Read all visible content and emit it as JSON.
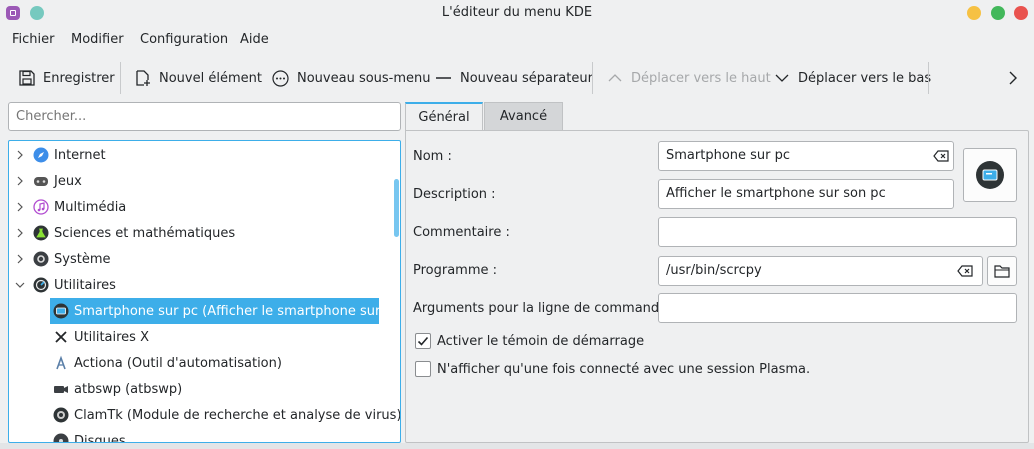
{
  "window": {
    "title": "L'éditeur du menu KDE"
  },
  "menubar": {
    "items": [
      "Fichier",
      "Modifier",
      "Configuration",
      "Aide"
    ]
  },
  "toolbar": {
    "save": "Enregistrer",
    "new_item": "Nouvel élément",
    "new_submenu": "Nouveau sous-menu",
    "new_separator": "Nouveau séparateur",
    "move_up": "Déplacer vers le haut",
    "move_down": "Déplacer vers le bas"
  },
  "search": {
    "placeholder": "Chercher..."
  },
  "tree": {
    "items": [
      {
        "label": "Internet",
        "icon": "internet-globe-icon"
      },
      {
        "label": "Jeux",
        "icon": "gamepad-icon"
      },
      {
        "label": "Multimédia",
        "icon": "music-note-icon"
      },
      {
        "label": "Sciences et mathématiques",
        "icon": "science-flask-icon"
      },
      {
        "label": "Système",
        "icon": "system-gear-icon"
      },
      {
        "label": "Utilitaires",
        "icon": "utilities-gauge-icon",
        "expanded": true
      },
      {
        "label": "Smartphone sur pc (Afficher le smartphone sur so...",
        "icon": "smartphone-screen-icon",
        "selected": true
      },
      {
        "label": "Utilitaires X",
        "icon": "x-logo-icon"
      },
      {
        "label": "Actiona (Outil d'automatisation)",
        "icon": "actiona-icon"
      },
      {
        "label": "atbswp (atbswp)",
        "icon": "camera-icon"
      },
      {
        "label": "ClamTk (Module de recherche et analyse de virus)",
        "icon": "clamtk-icon"
      },
      {
        "label": "Disques",
        "icon": "disk-icon"
      }
    ]
  },
  "tabs": {
    "general": "Général",
    "advanced": "Avancé"
  },
  "form": {
    "name_label": "Nom :",
    "name_value": "Smartphone sur pc",
    "description_label": "Description :",
    "description_value": "Afficher le smartphone sur son pc",
    "comment_label": "Commentaire :",
    "comment_value": "",
    "program_label": "Programme :",
    "program_value": "/usr/bin/scrcpy",
    "arguments_label": "Arguments pour la ligne de commandes :",
    "arguments_value": "",
    "startup_feedback_label": "Activer le témoin de démarrage",
    "startup_feedback_checked": true,
    "plasma_only_label": "N'afficher qu'une fois connecté avec une session Plasma.",
    "plasma_only_checked": false
  },
  "colors": {
    "accent": "#3daee9",
    "background": "#eff0f1",
    "text": "#232629"
  }
}
